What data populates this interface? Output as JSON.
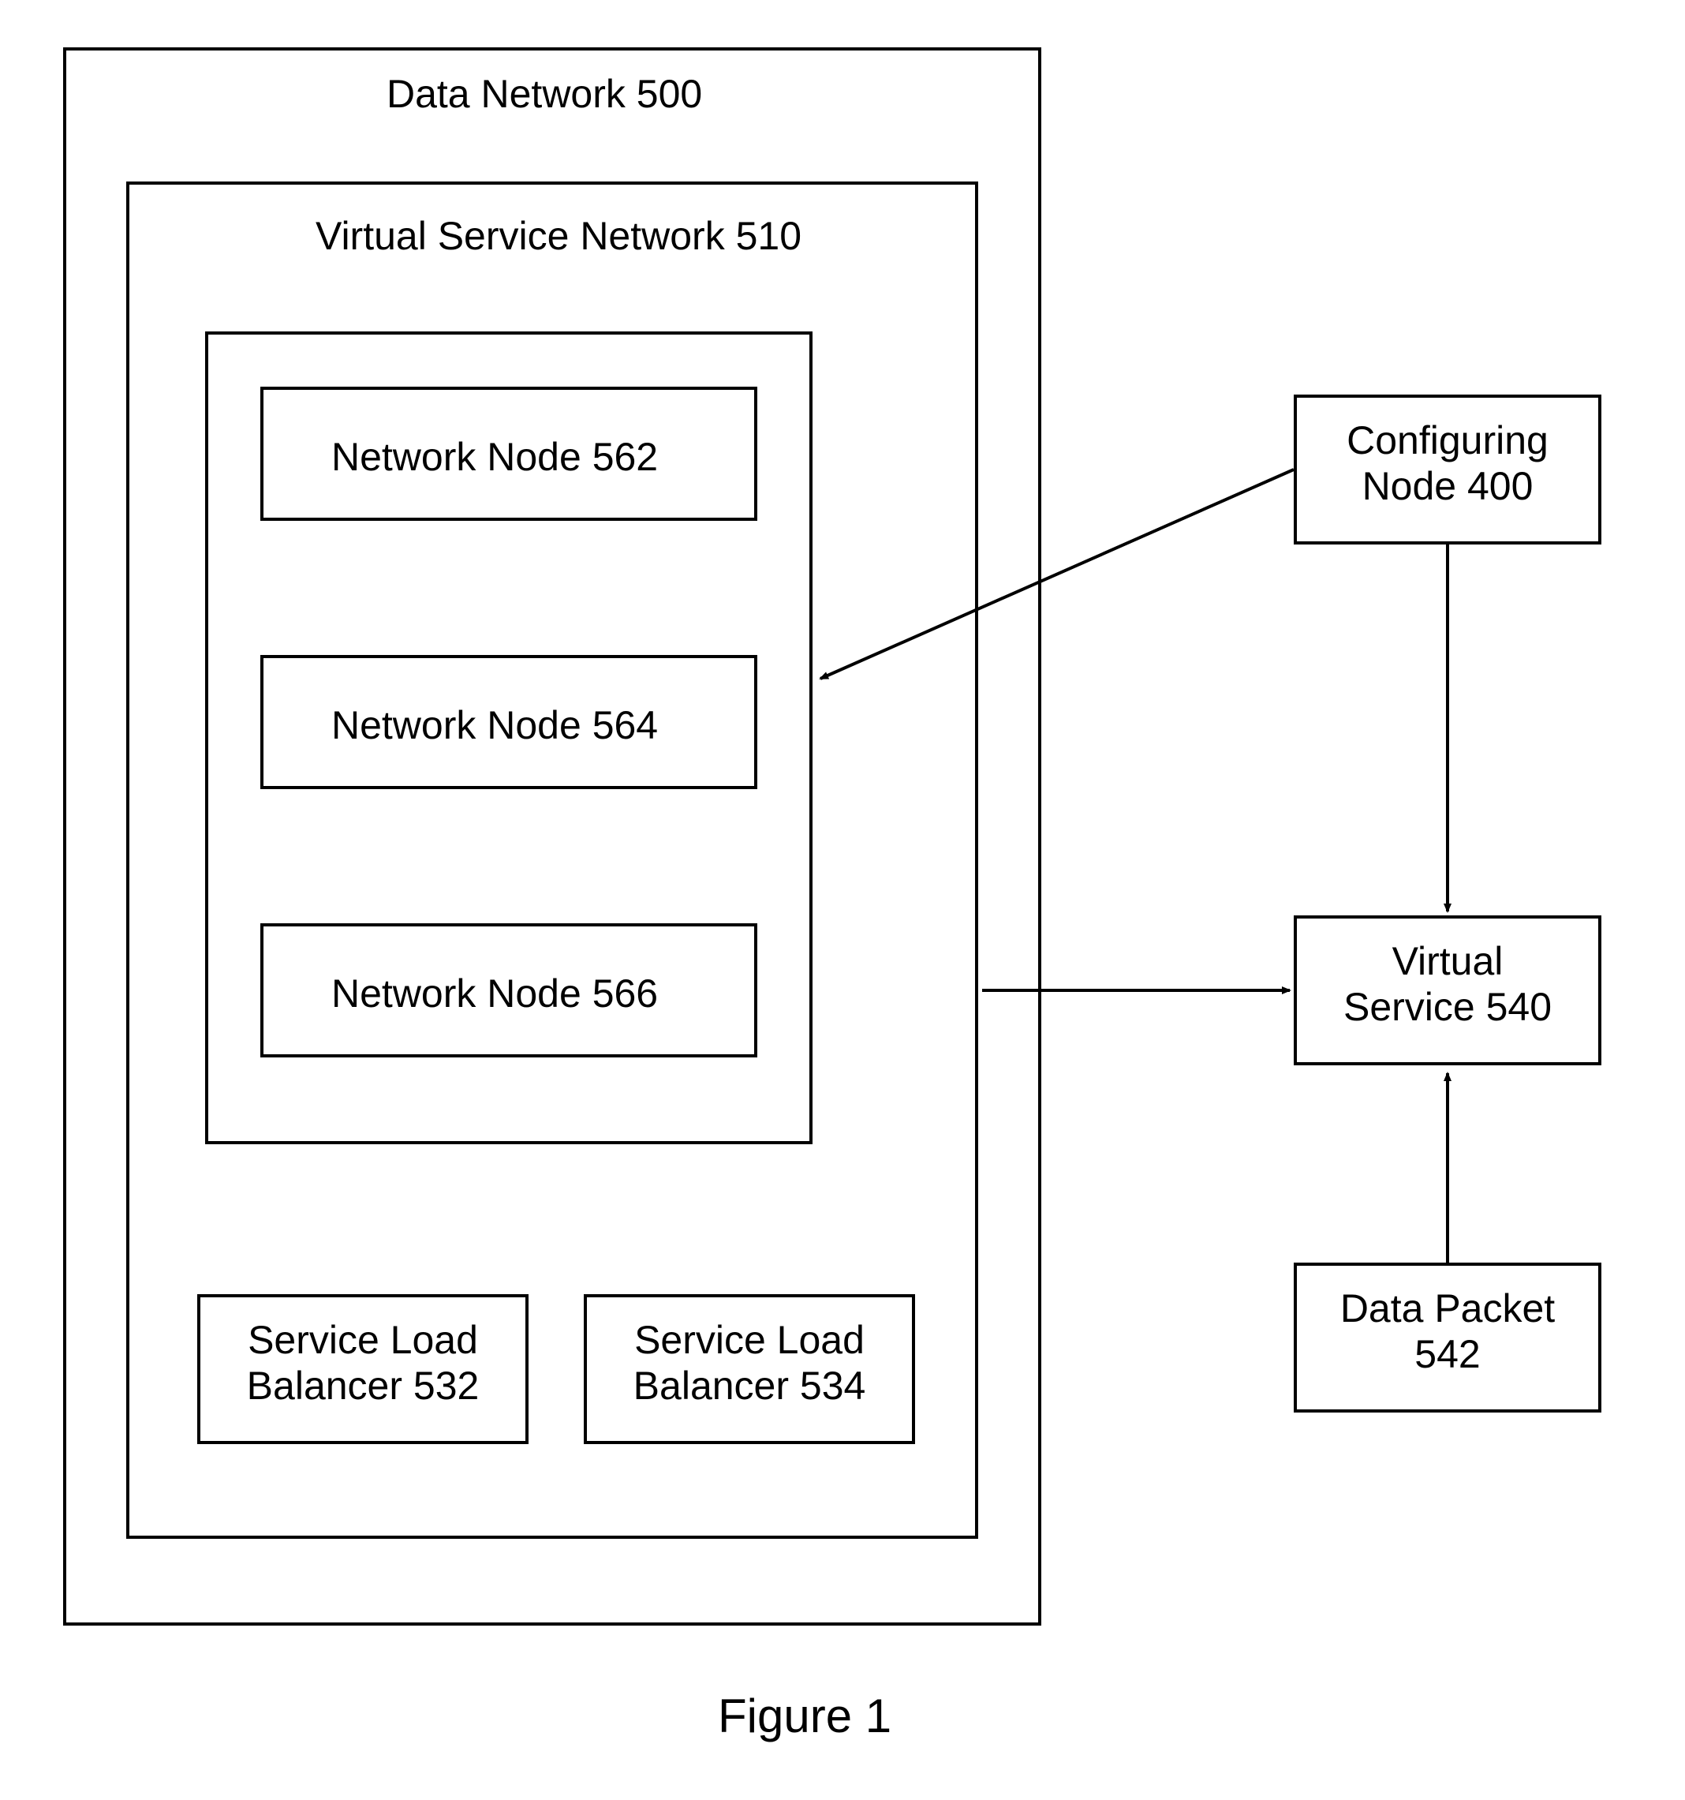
{
  "dataNetwork": {
    "title": "Data Network 500"
  },
  "virtualServiceNetwork": {
    "title": "Virtual Service Network 510"
  },
  "innerGroup": {
    "node562": "Network Node 562",
    "node564": "Network Node 564",
    "node566": "Network Node 566"
  },
  "balancers": {
    "b532": {
      "line1": "Service Load",
      "line2": "Balancer 532"
    },
    "b534": {
      "line1": "Service Load",
      "line2": "Balancer 534"
    }
  },
  "configuringNode": {
    "line1": "Configuring",
    "line2": "Node 400"
  },
  "virtualService": {
    "line1": "Virtual",
    "line2": "Service 540"
  },
  "dataPacket": {
    "line1": "Data Packet",
    "line2": "542"
  },
  "figure": "Figure 1"
}
